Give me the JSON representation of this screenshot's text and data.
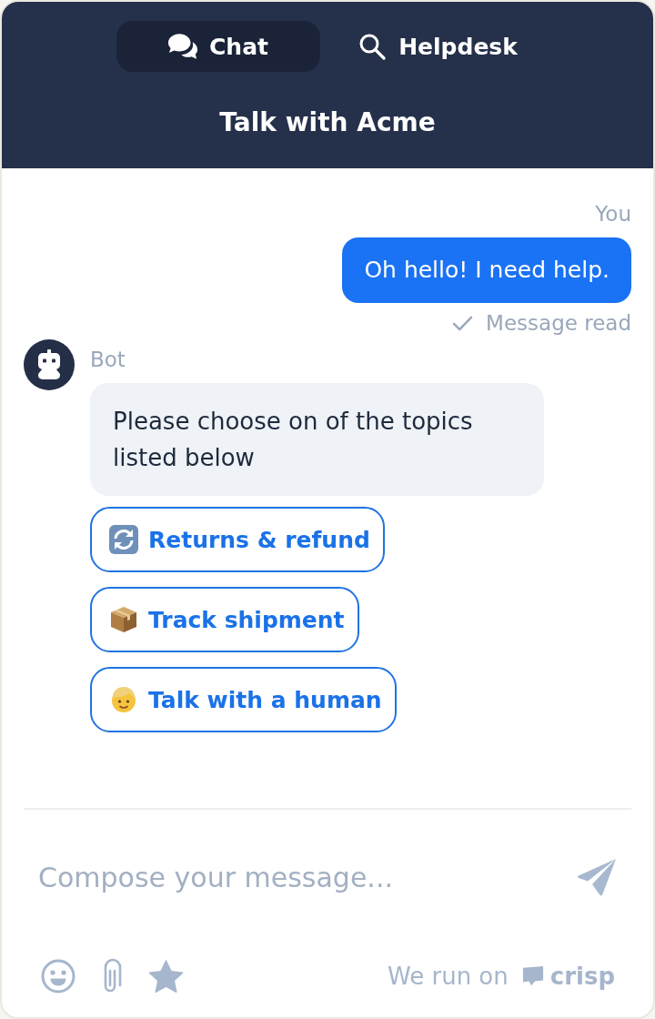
{
  "header": {
    "tabs": [
      {
        "label": "Chat",
        "selected": true
      },
      {
        "label": "Helpdesk",
        "selected": false
      }
    ],
    "title": "Talk with Acme"
  },
  "messages": [
    {
      "kind": "user",
      "sender": "You",
      "text": "Oh hello! I need help.",
      "status": "Message read"
    },
    {
      "kind": "bot",
      "sender": "Bot",
      "text": "Please choose on of the topics listed below",
      "quick_replies": [
        "Returns & refund",
        "Track shipment",
        "Talk with a human"
      ]
    }
  ],
  "composer": {
    "placeholder": "Compose your message..."
  },
  "footer": {
    "branding": "We run on",
    "brand": "crisp"
  }
}
